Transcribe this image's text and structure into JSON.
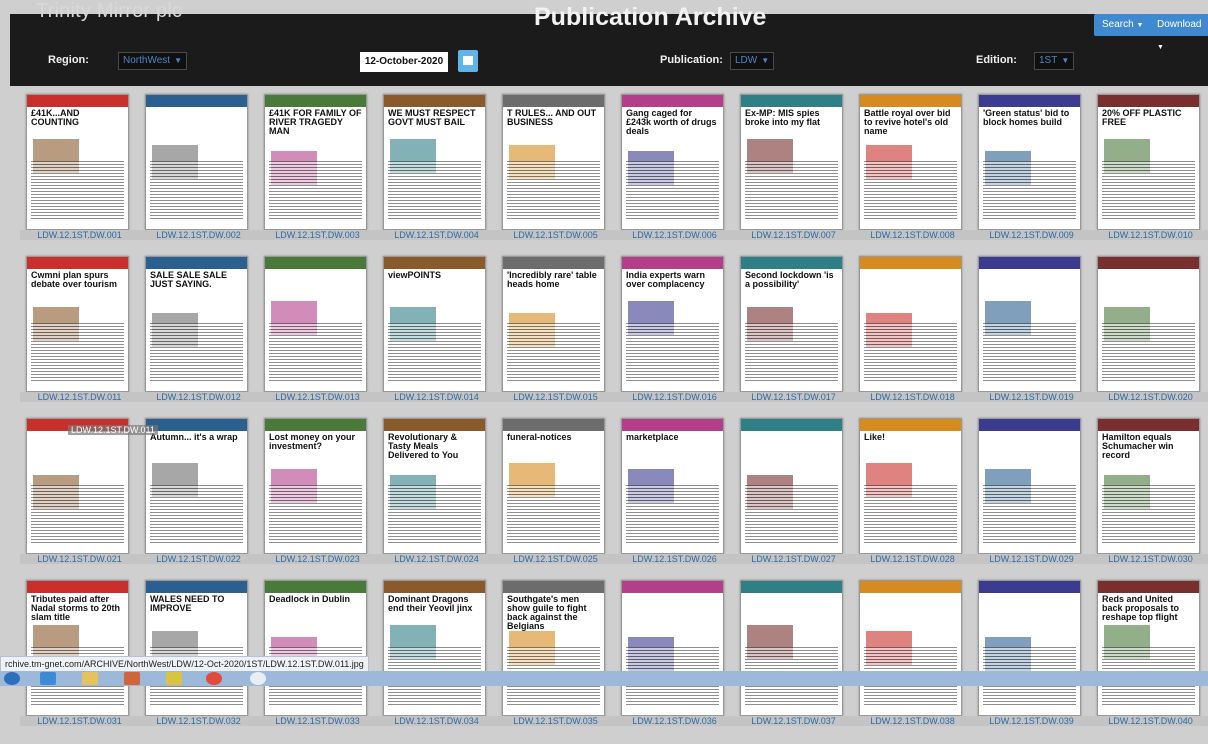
{
  "header": {
    "brand": "Trinity Mirror plc",
    "title": "Publication Archive",
    "search_label": "Search",
    "download_label": "Download",
    "region_label": "Region:",
    "region_value": "NorthWest",
    "date_value": "12-October-2020",
    "publication_label": "Publication:",
    "publication_value": "LDW",
    "edition_label": "Edition:",
    "edition_value": "1ST",
    "accent": "#3f89d1"
  },
  "thumbnails": [
    {
      "code": "LDW.12.1ST.DW.001",
      "headline": "£41K...AND COUNTING",
      "mast": "DAILY POST"
    },
    {
      "code": "LDW.12.1ST.DW.002",
      "headline": ""
    },
    {
      "code": "LDW.12.1ST.DW.003",
      "headline": "£41K FOR FAMILY OF RIVER TRAGEDY MAN"
    },
    {
      "code": "LDW.12.1ST.DW.004",
      "headline": "WE MUST RESPECT GOVT MUST BAIL"
    },
    {
      "code": "LDW.12.1ST.DW.005",
      "headline": "T RULES... AND OUT BUSINESS"
    },
    {
      "code": "LDW.12.1ST.DW.006",
      "headline": "Gang caged for £243k worth of drugs deals"
    },
    {
      "code": "LDW.12.1ST.DW.007",
      "headline": "Ex-MP: MIS spies broke into my flat"
    },
    {
      "code": "LDW.12.1ST.DW.008",
      "headline": "Battle royal over bid to revive hotel's old name"
    },
    {
      "code": "LDW.12.1ST.DW.009",
      "headline": "'Green status' bid to block homes build"
    },
    {
      "code": "LDW.12.1ST.DW.010",
      "headline": "20% OFF PLASTIC FREE"
    },
    {
      "code": "LDW.12.1ST.DW.011",
      "headline": "Cwmni plan spurs debate over tourism"
    },
    {
      "code": "LDW.12.1ST.DW.012",
      "headline": "SALE SALE SALE JUST SAYING."
    },
    {
      "code": "LDW.12.1ST.DW.013",
      "headline": ""
    },
    {
      "code": "LDW.12.1ST.DW.014",
      "headline": "viewPOINTS"
    },
    {
      "code": "LDW.12.1ST.DW.015",
      "headline": "'Incredibly rare' table heads home"
    },
    {
      "code": "LDW.12.1ST.DW.016",
      "headline": "India experts warn over complacency"
    },
    {
      "code": "LDW.12.1ST.DW.017",
      "headline": "Second lockdown 'is a possibility'"
    },
    {
      "code": "LDW.12.1ST.DW.018",
      "headline": ""
    },
    {
      "code": "LDW.12.1ST.DW.019",
      "headline": ""
    },
    {
      "code": "LDW.12.1ST.DW.020",
      "headline": ""
    },
    {
      "code": "LDW.12.1ST.DW.021",
      "headline": ""
    },
    {
      "code": "LDW.12.1ST.DW.022",
      "headline": "Autumn... it's a wrap"
    },
    {
      "code": "LDW.12.1ST.DW.023",
      "headline": "Lost money on your investment?"
    },
    {
      "code": "LDW.12.1ST.DW.024",
      "headline": "Revolutionary & Tasty Meals Delivered to You"
    },
    {
      "code": "LDW.12.1ST.DW.025",
      "headline": "funeral-notices"
    },
    {
      "code": "LDW.12.1ST.DW.026",
      "headline": "marketplace"
    },
    {
      "code": "LDW.12.1ST.DW.027",
      "headline": ""
    },
    {
      "code": "LDW.12.1ST.DW.028",
      "headline": "Like!"
    },
    {
      "code": "LDW.12.1ST.DW.029",
      "headline": ""
    },
    {
      "code": "LDW.12.1ST.DW.030",
      "headline": "Hamilton equals Schumacher win record"
    },
    {
      "code": "LDW.12.1ST.DW.031",
      "headline": "Tributes paid after Nadal storms to 20th slam title"
    },
    {
      "code": "LDW.12.1ST.DW.032",
      "headline": "WALES NEED TO IMPROVE"
    },
    {
      "code": "LDW.12.1ST.DW.033",
      "headline": "Deadlock in Dublin"
    },
    {
      "code": "LDW.12.1ST.DW.034",
      "headline": "Dominant Dragons end their Yeovil jinx"
    },
    {
      "code": "LDW.12.1ST.DW.035",
      "headline": "Southgate's men show guile to fight back against the Belgians"
    },
    {
      "code": "LDW.12.1ST.DW.036",
      "headline": ""
    },
    {
      "code": "LDW.12.1ST.DW.037",
      "headline": ""
    },
    {
      "code": "LDW.12.1ST.DW.038",
      "headline": ""
    },
    {
      "code": "LDW.12.1ST.DW.039",
      "headline": ""
    },
    {
      "code": "LDW.12.1ST.DW.040",
      "headline": "Reds and United back proposals to reshape top flight"
    }
  ],
  "tooltip": "LDW.12.1ST.DW.011",
  "status_url": "rchive.tm-gnet.com/ARCHIVE/NorthWest/LDW/12-Oct-2020/1ST/LDW.12.1ST.DW.011.jpg"
}
